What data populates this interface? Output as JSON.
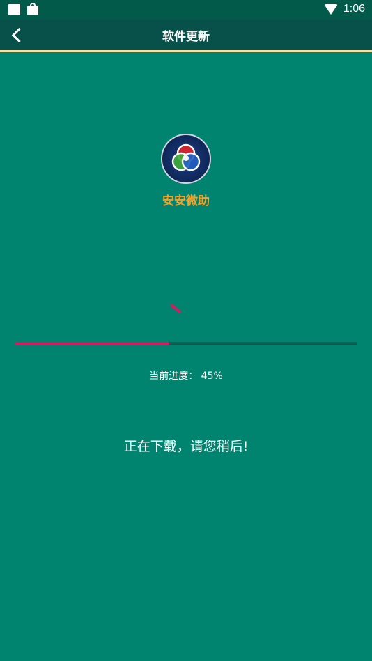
{
  "status_bar": {
    "time": "1:06",
    "icons": [
      "square-notification-icon",
      "bag-notification-icon",
      "wifi-icon"
    ]
  },
  "app_bar": {
    "title": "软件更新",
    "back_icon": "chevron-left-icon"
  },
  "app": {
    "name": "安安微助",
    "logo_icon": "rgb-circles-logo"
  },
  "progress": {
    "label": "当前进度：",
    "value_text": "45%",
    "value": 0.45
  },
  "message": "正在下载，请您稍后!",
  "colors": {
    "background": "#00836f",
    "app_bar": "#08504a",
    "accent": "#d81b60",
    "app_name": "#f0a22a",
    "divider": "#f3e3a0"
  }
}
